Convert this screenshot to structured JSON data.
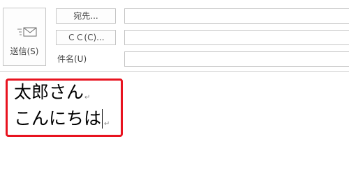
{
  "header": {
    "send_label": "送信(S)",
    "to_label": "宛先...",
    "cc_label": "ＣＣ(C)...",
    "subject_label": "件名(U)",
    "to_value": "",
    "cc_value": "",
    "subject_value": ""
  },
  "body": {
    "line1": "太郎さん",
    "line2": "こんにちは",
    "paragraph_mark": "↵"
  },
  "colors": {
    "highlight": "#e8131f"
  }
}
